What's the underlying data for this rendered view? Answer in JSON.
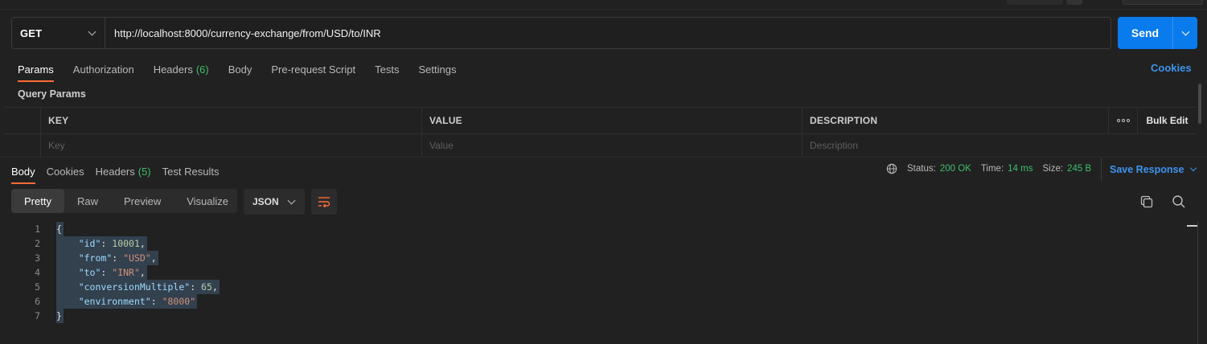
{
  "request": {
    "method": "GET",
    "url": "http://localhost:8000/currency-exchange/from/USD/to/INR",
    "send_label": "Send"
  },
  "request_tabs": [
    {
      "label": "Params",
      "badge": ""
    },
    {
      "label": "Authorization",
      "badge": ""
    },
    {
      "label": "Headers",
      "badge": "(6)"
    },
    {
      "label": "Body",
      "badge": ""
    },
    {
      "label": "Pre-request Script",
      "badge": ""
    },
    {
      "label": "Tests",
      "badge": ""
    },
    {
      "label": "Settings",
      "badge": ""
    }
  ],
  "cookies_link": "Cookies",
  "query_params": {
    "title": "Query Params",
    "headers": {
      "key": "KEY",
      "value": "VALUE",
      "description": "DESCRIPTION",
      "bulk_edit": "Bulk Edit"
    },
    "placeholders": {
      "key": "Key",
      "value": "Value",
      "description": "Description"
    }
  },
  "response_tabs": [
    {
      "label": "Body",
      "badge": ""
    },
    {
      "label": "Cookies",
      "badge": ""
    },
    {
      "label": "Headers",
      "badge": "(5)"
    },
    {
      "label": "Test Results",
      "badge": ""
    }
  ],
  "response_status": {
    "status_label": "Status:",
    "status_value": "200 OK",
    "time_label": "Time:",
    "time_value": "14 ms",
    "size_label": "Size:",
    "size_value": "245 B",
    "save_label": "Save Response"
  },
  "view_modes": [
    "Pretty",
    "Raw",
    "Preview",
    "Visualize"
  ],
  "format": "JSON",
  "line_numbers": [
    "1",
    "2",
    "3",
    "4",
    "5",
    "6",
    "7"
  ],
  "json_body": {
    "open": "{",
    "close": "}",
    "fields": [
      {
        "key": "\"id\"",
        "value": "10001",
        "type": "number",
        "comma": ","
      },
      {
        "key": "\"from\"",
        "value": "\"USD\"",
        "type": "string",
        "comma": ","
      },
      {
        "key": "\"to\"",
        "value": "\"INR\"",
        "type": "string",
        "comma": ","
      },
      {
        "key": "\"conversionMultiple\"",
        "value": "65",
        "type": "number",
        "comma": ","
      },
      {
        "key": "\"environment\"",
        "value": "\"8000\"",
        "type": "string",
        "comma": ""
      }
    ]
  },
  "colors": {
    "accent_orange": "#ff6c37",
    "send_blue": "#097bed",
    "link_blue": "#3d94ef",
    "status_green": "#3fbf6a",
    "json_key": "#9cdcfe",
    "json_number": "#b5cea8",
    "json_string": "#ce9178"
  },
  "icons": [
    "globe-icon",
    "wrap-lines-icon",
    "copy-icon",
    "search-icon",
    "more-options-icon",
    "chevron-down-icon"
  ]
}
